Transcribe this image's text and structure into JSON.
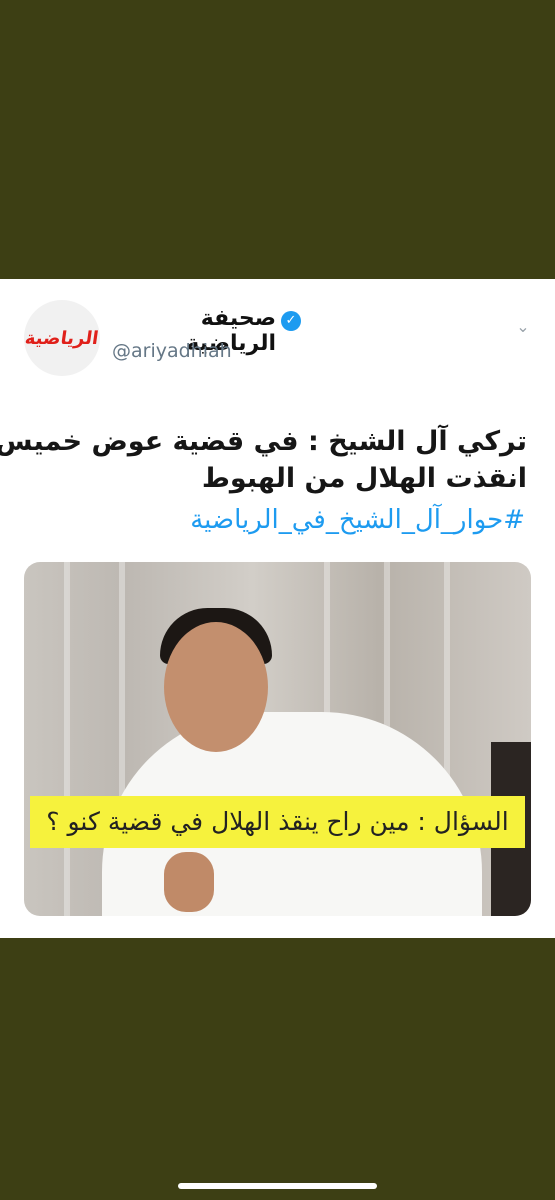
{
  "tweet": {
    "display_name": "صحيفة الرياضية",
    "handle": "@ariyadhiah",
    "avatar_logo_text": "الرياضية",
    "text_line1": "تركي آل الشيخ : في قضية عوض خميس",
    "text_line2": "انقذت الهلال من الهبوط",
    "hashtag": "#حوار_آل_الشيخ_في_الرياضية"
  },
  "image": {
    "caption": "السؤال : مين راح ينقذ الهلال في قضية كنو ؟"
  },
  "colors": {
    "background": "#3d3f14",
    "accent": "#1d9bf0",
    "caption_bg": "#f6f23d"
  },
  "icons": {
    "verified": "verified-badge-icon",
    "chevron": "chevron-down-icon"
  }
}
